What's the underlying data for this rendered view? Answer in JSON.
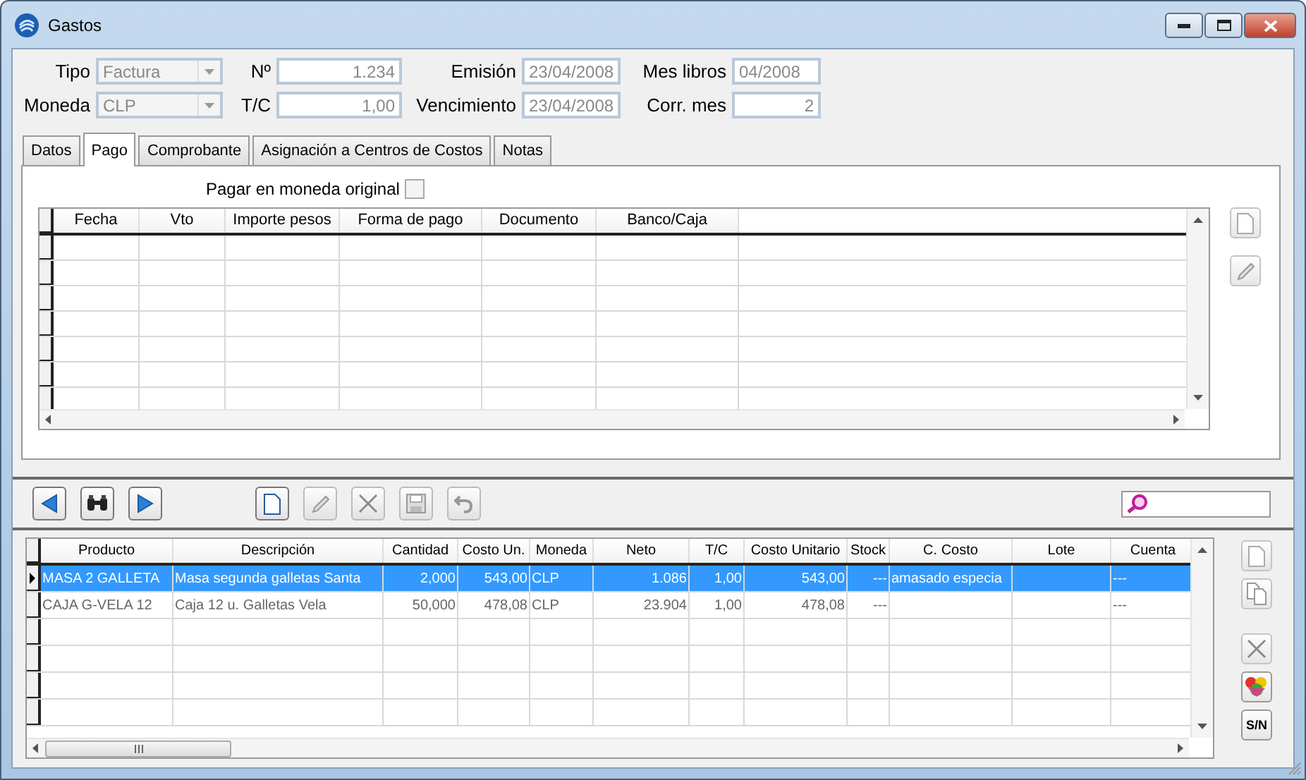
{
  "window": {
    "title": "Gastos"
  },
  "header_fields": [
    {
      "label": "Tipo",
      "kind": "combo",
      "value": "Factura"
    },
    {
      "label": "Nº",
      "kind": "number",
      "value": "1.234"
    },
    {
      "label": "Emisión",
      "kind": "date",
      "value": "23/04/2008"
    },
    {
      "label": "Mes libros",
      "kind": "date",
      "value": "04/2008"
    },
    {
      "label": "Moneda",
      "kind": "combo",
      "value": "CLP"
    },
    {
      "label": "T/C",
      "kind": "number",
      "value": "1,00"
    },
    {
      "label": "Vencimiento",
      "kind": "date",
      "value": "23/04/2008"
    },
    {
      "label": "Corr. mes",
      "kind": "number",
      "value": "2"
    }
  ],
  "tabs": [
    {
      "label": "Datos",
      "selected": false
    },
    {
      "label": "Pago",
      "selected": true
    },
    {
      "label": "Comprobante",
      "selected": false
    },
    {
      "label": "Asignación a Centros de Costos",
      "selected": false
    },
    {
      "label": "Notas",
      "selected": false
    }
  ],
  "pago": {
    "checkbox": {
      "label": "Pagar en moneda original",
      "checked": false
    },
    "table": {
      "columns": [
        "Fecha",
        "Vto",
        "Importe pesos",
        "Forma de pago",
        "Documento",
        "Banco/Caja"
      ]
    },
    "side_buttons": [
      {
        "kind": "new",
        "disabled": true
      },
      {
        "kind": "edit",
        "disabled": true
      }
    ]
  },
  "toolbar": [
    {
      "kind": "prev",
      "disabled": false
    },
    {
      "kind": "find",
      "disabled": false
    },
    {
      "kind": "next",
      "disabled": false
    },
    {
      "kind": "new",
      "disabled": false
    },
    {
      "kind": "edit",
      "disabled": true
    },
    {
      "kind": "delete",
      "disabled": true
    },
    {
      "kind": "save",
      "disabled": true
    },
    {
      "kind": "undo",
      "disabled": true
    }
  ],
  "items": {
    "columns": [
      "Producto",
      "Descripción",
      "Cantidad",
      "Costo Un.",
      "Moneda",
      "Neto",
      "T/C",
      "Costo Unitario",
      "Stock",
      "C. Costo",
      "Lote",
      "Cuenta"
    ],
    "rows": [
      {
        "selected": true,
        "cells": [
          "MASA 2 GALLETA",
          "Masa segunda galletas Santa",
          "2,000",
          "543,00",
          "CLP",
          "1.086",
          "1,00",
          "543,00",
          "---",
          "amasado especia",
          "",
          "---"
        ]
      },
      {
        "selected": false,
        "cells": [
          "CAJA G-VELA 12",
          "Caja 12 u. Galletas Vela",
          "50,000",
          "478,08",
          "CLP",
          "23.904",
          "1,00",
          "478,08",
          "---",
          "",
          "",
          "---"
        ]
      }
    ]
  },
  "side_buttons": [
    {
      "kind": "new",
      "disabled": true
    },
    {
      "kind": "copy",
      "disabled": true
    },
    {
      "kind": "delete",
      "disabled": true
    },
    {
      "kind": "colors",
      "disabled": false
    },
    {
      "kind": "text",
      "label": "S/N",
      "disabled": false
    }
  ]
}
